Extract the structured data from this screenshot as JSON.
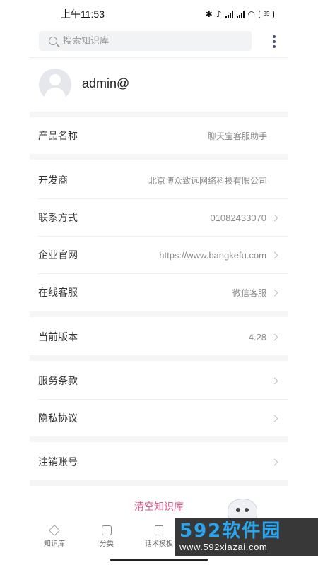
{
  "status": {
    "time": "上午11:53",
    "battery": "85"
  },
  "search": {
    "placeholder": "搜索知识库"
  },
  "profile": {
    "username": "admin@"
  },
  "rows": [
    {
      "label": "产品名称",
      "value": "聊天宝客服助手"
    },
    {
      "label": "开发商",
      "value": "北京博众致远网络科技有限公司"
    },
    {
      "label": "联系方式",
      "value": "01082433070"
    },
    {
      "label": "企业官网",
      "value": "https://www.bangkefu.com"
    },
    {
      "label": "在线客服",
      "value": "微信客服"
    },
    {
      "label": "当前版本",
      "value": "4.28"
    },
    {
      "label": "服务条款",
      "value": ""
    },
    {
      "label": "隐私协议",
      "value": ""
    },
    {
      "label": "注销账号",
      "value": ""
    }
  ],
  "actions": {
    "clear_kb": "清空知识库"
  },
  "tabs": [
    {
      "label": "知识库",
      "icon": "layers-icon"
    },
    {
      "label": "分类",
      "icon": "cube-icon"
    },
    {
      "label": "话术模板",
      "icon": "document-icon"
    }
  ],
  "watermark": {
    "brand": "592软件园",
    "url": "www.592xiazai.com"
  }
}
